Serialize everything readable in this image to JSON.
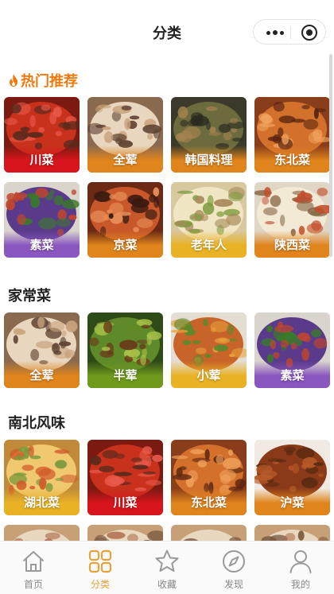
{
  "nav": {
    "title": "分类"
  },
  "sections": [
    {
      "title": "热门推荐",
      "hot": true,
      "items": [
        {
          "label": "川菜",
          "photo": "red-chili",
          "band": "red"
        },
        {
          "label": "全荤",
          "photo": "pork-platter",
          "band": "orange"
        },
        {
          "label": "韩国料理",
          "photo": "korean-dish",
          "band": "orange"
        },
        {
          "label": "东北菜",
          "photo": "noodle-dish",
          "band": "orange"
        },
        {
          "label": "素菜",
          "photo": "eggplant",
          "band": "purple"
        },
        {
          "label": "京菜",
          "photo": "roast-duck",
          "band": "orange"
        },
        {
          "label": "老年人",
          "photo": "soup",
          "band": "yellow"
        },
        {
          "label": "陕西菜",
          "photo": "noodle-bowl",
          "band": "orange"
        }
      ]
    },
    {
      "title": "家常菜",
      "hot": false,
      "items": [
        {
          "label": "全荤",
          "photo": "pork-platter",
          "band": "orange"
        },
        {
          "label": "半荤",
          "photo": "green-pepper",
          "band": "green"
        },
        {
          "label": "小荤",
          "photo": "kungpao",
          "band": "yellow"
        },
        {
          "label": "素菜",
          "photo": "eggplant",
          "band": "purple"
        }
      ]
    },
    {
      "title": "南北风味",
      "hot": false,
      "items": [
        {
          "label": "湖北菜",
          "photo": "fish-dish",
          "band": "yellow"
        },
        {
          "label": "川菜",
          "photo": "red-chili",
          "band": "red"
        },
        {
          "label": "东北菜",
          "photo": "noodle-dish",
          "band": "orange"
        },
        {
          "label": "沪菜",
          "photo": "braised-balls",
          "band": "orange"
        }
      ]
    }
  ],
  "tabbar": {
    "items": [
      {
        "label": "首页",
        "icon": "home-icon",
        "active": false
      },
      {
        "label": "分类",
        "icon": "category-grid-icon",
        "active": true
      },
      {
        "label": "收藏",
        "icon": "star-icon",
        "active": false
      },
      {
        "label": "发现",
        "icon": "compass-icon",
        "active": false
      },
      {
        "label": "我的",
        "icon": "user-icon",
        "active": false
      }
    ]
  },
  "colors": {
    "accent": "#f07a10",
    "tab_active": "#e8a23a",
    "tab_inactive": "#999999",
    "band_red": "#d8151c",
    "band_orange": "#e0841c",
    "band_yellow": "#e9b224",
    "band_purple": "#8a56c0",
    "band_green": "#6f9a1c"
  }
}
